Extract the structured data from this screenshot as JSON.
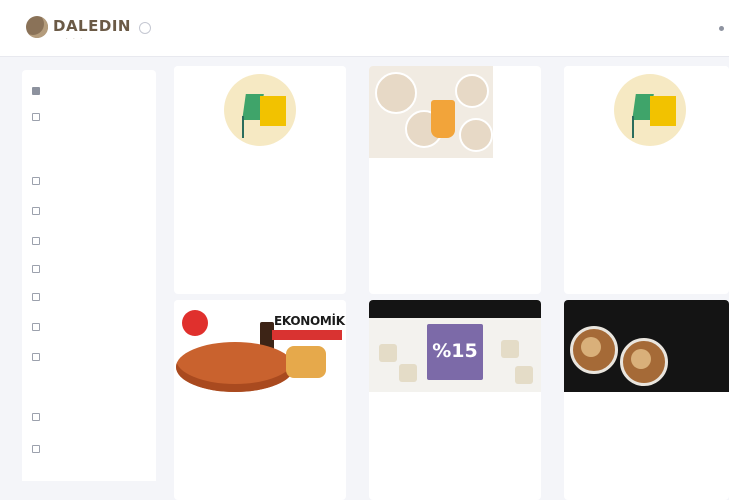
{
  "brand": {
    "logo_text": "DALEDIN",
    "logo_sub": "· · ·"
  },
  "user": {
    "name": ""
  },
  "sidebar": {
    "items": [
      {
        "label": ""
      },
      {
        "label": ""
      }
    ],
    "section1_title": "",
    "section1_items": [
      {
        "label": ""
      },
      {
        "label": ""
      },
      {
        "label": ""
      },
      {
        "label": ""
      },
      {
        "label": ""
      },
      {
        "label": ""
      },
      {
        "label": ""
      }
    ],
    "section2_title": "",
    "section2_items": [
      {
        "label": ""
      },
      {
        "label": ""
      }
    ]
  },
  "cards": [
    {
      "title": "",
      "description": "",
      "link": "",
      "image": "placeholder"
    },
    {
      "title": "",
      "description": "",
      "link": "",
      "image": "food"
    },
    {
      "title": "",
      "description": "",
      "link": "",
      "image": "placeholder"
    },
    {
      "title": "",
      "description": "",
      "image": "pizza",
      "banner_text": "EKONOMİK!"
    },
    {
      "title": "",
      "description": "",
      "image": "campaign",
      "badge_text": "%15"
    },
    {
      "title": "",
      "description": "",
      "image": "coffee"
    }
  ],
  "colors": {
    "background": "#f4f5f9",
    "card": "#ffffff",
    "accent_link": "#7f9fd8",
    "section_title": "#8aa0c8"
  }
}
